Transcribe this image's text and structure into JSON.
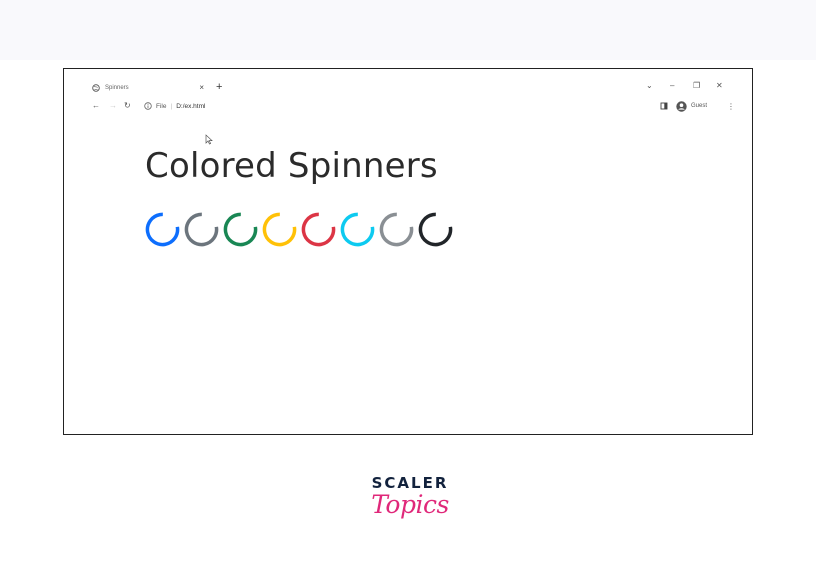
{
  "browser": {
    "tab_title": "Spinners",
    "tab_close": "×",
    "new_tab": "+",
    "window_controls": [
      "⌄",
      "–",
      "❐",
      "✕"
    ],
    "nav": {
      "back": "←",
      "forward": "→",
      "reload": "↻"
    },
    "address": {
      "scheme_label": "File",
      "url": "D:/ex.html"
    },
    "profile_label": "Guest",
    "menu": "⋮"
  },
  "page": {
    "heading": "Colored Spinners",
    "spinner_colors": [
      "#0d6efd",
      "#6c757d",
      "#198754",
      "#ffc107",
      "#dc3545",
      "#0dcaf0",
      "#8a8f94",
      "#212529"
    ]
  },
  "logo": {
    "line1": "SCALER",
    "line2": "Topics"
  }
}
